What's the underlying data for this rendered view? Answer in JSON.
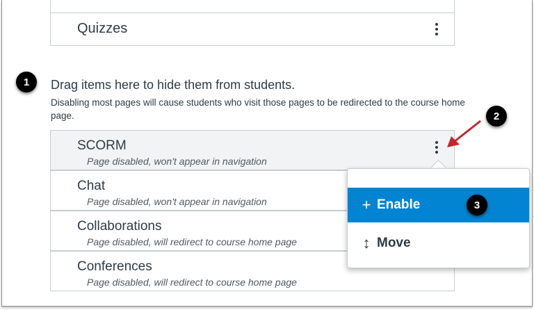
{
  "enabled_list": {
    "items": [
      {
        "label": "Quizzes"
      }
    ]
  },
  "hidden_section": {
    "heading": "Drag items here to hide them from students.",
    "description": "Disabling most pages will cause students who visit those pages to be redirected to the course home page."
  },
  "disabled_list": {
    "items": [
      {
        "label": "SCORM",
        "status": "Page disabled, won't appear in navigation"
      },
      {
        "label": "Chat",
        "status": "Page disabled, won't appear in navigation"
      },
      {
        "label": "Collaborations",
        "status": "Page disabled, will redirect to course home page"
      },
      {
        "label": "Conferences",
        "status": "Page disabled, will redirect to course home page"
      }
    ]
  },
  "options_menu": {
    "items": [
      {
        "label": "Enable",
        "icon": "plus-icon"
      },
      {
        "label": "Move",
        "icon": "up-down-arrow-icon"
      }
    ]
  },
  "callouts": [
    "1",
    "2",
    "3"
  ],
  "colors": {
    "accent": "#0384d2",
    "callout_arrow": "#c0282d",
    "text": "#2d3b45"
  }
}
